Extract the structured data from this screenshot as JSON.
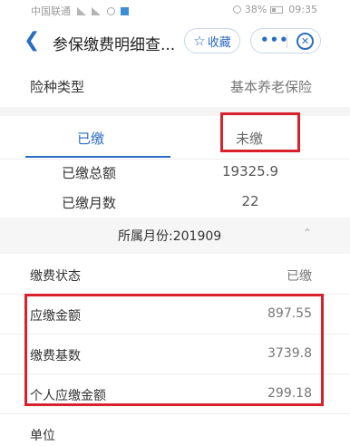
{
  "status_bar": {
    "carrier": "中国联通",
    "battery": "38%",
    "time": "09:35"
  },
  "nav": {
    "back_icon": "chevron-left-icon",
    "title": "参保缴费明细查...",
    "favorite_label": "收藏",
    "more_icon": "more-dots-icon",
    "close_icon": "close-circle-icon"
  },
  "insurance": {
    "label": "险种类型",
    "value": "基本养老保险"
  },
  "tabs": {
    "paid": "已缴",
    "unpaid": "未缴",
    "active": "paid"
  },
  "summary": {
    "total_label": "已缴总额",
    "total_value": "19325.9",
    "months_label": "已缴月数",
    "months_value": "22"
  },
  "month": {
    "label": "所属月份:201909"
  },
  "details": {
    "status_label": "缴费状态",
    "status_value": "已缴",
    "due_label": "应缴金额",
    "due_value": "897.55",
    "base_label": "缴费基数",
    "base_value": "3739.8",
    "personal_label": "个人应缴金额",
    "personal_value": "299.18",
    "unit_label": "单位"
  },
  "colors": {
    "accent": "#2b6cc4",
    "highlight_box": "#d9212e"
  }
}
